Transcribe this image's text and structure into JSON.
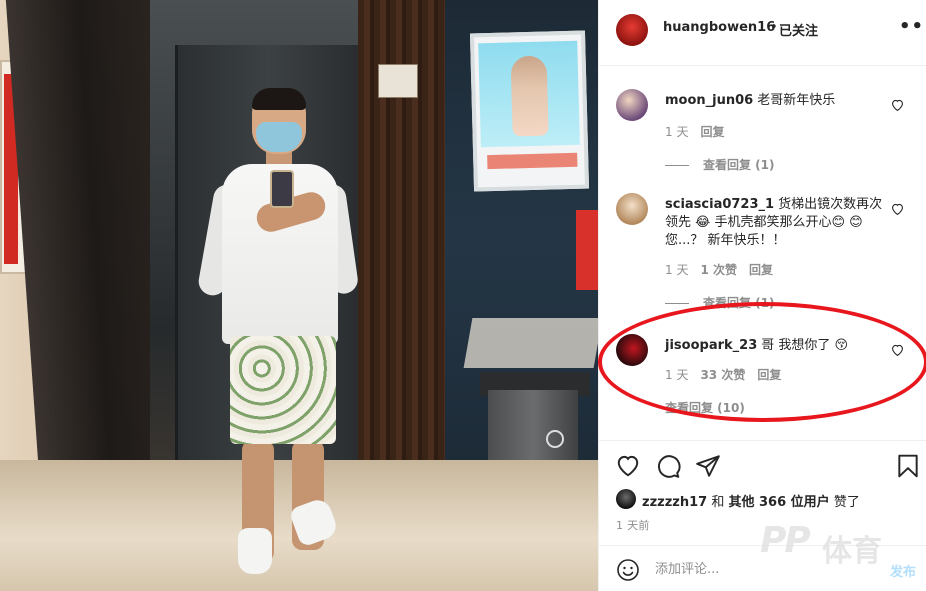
{
  "post": {
    "username": "huangbowen16",
    "separator": "•",
    "follow_status": "已关注",
    "more_icon": "more-horizontal-icon"
  },
  "comments": [
    {
      "username": "moon_jun06",
      "text": "老哥新年快乐",
      "time": "1 天",
      "likes": "",
      "reply_label": "回复",
      "view_replies": "查看回复 (1)"
    },
    {
      "username": "sciascia0723_1",
      "text": "货梯出镜次数再次领先 😂 手机壳都笑那么开心😊 😊 您...？ 新年快乐！！",
      "time": "1 天",
      "likes": "1 次赞",
      "reply_label": "回复",
      "view_replies": "查看回复 (1)"
    },
    {
      "username": "jisoopark_23",
      "text": "哥 我想你了 😚",
      "time": "1 天",
      "likes": "33 次赞",
      "reply_label": "回复",
      "view_replies": "查看回复 (10)"
    }
  ],
  "actions": {
    "like_icon": "heart-icon",
    "comment_icon": "comment-icon",
    "share_icon": "share-icon",
    "save_icon": "bookmark-icon"
  },
  "likes_summary": {
    "user": "zzzzzh17",
    "and": "和",
    "others": "其他 366 位用户",
    "suffix": "赞了"
  },
  "timestamp": "1 天前",
  "add_comment": {
    "placeholder": "添加评论...",
    "post_label": "发布"
  },
  "watermark": {
    "logo": "PP",
    "text": "体育"
  },
  "colors": {
    "highlight_circle": "#e8161d",
    "post_button_disabled": "#b2dffc",
    "secondary_text": "#8e8e8e"
  }
}
